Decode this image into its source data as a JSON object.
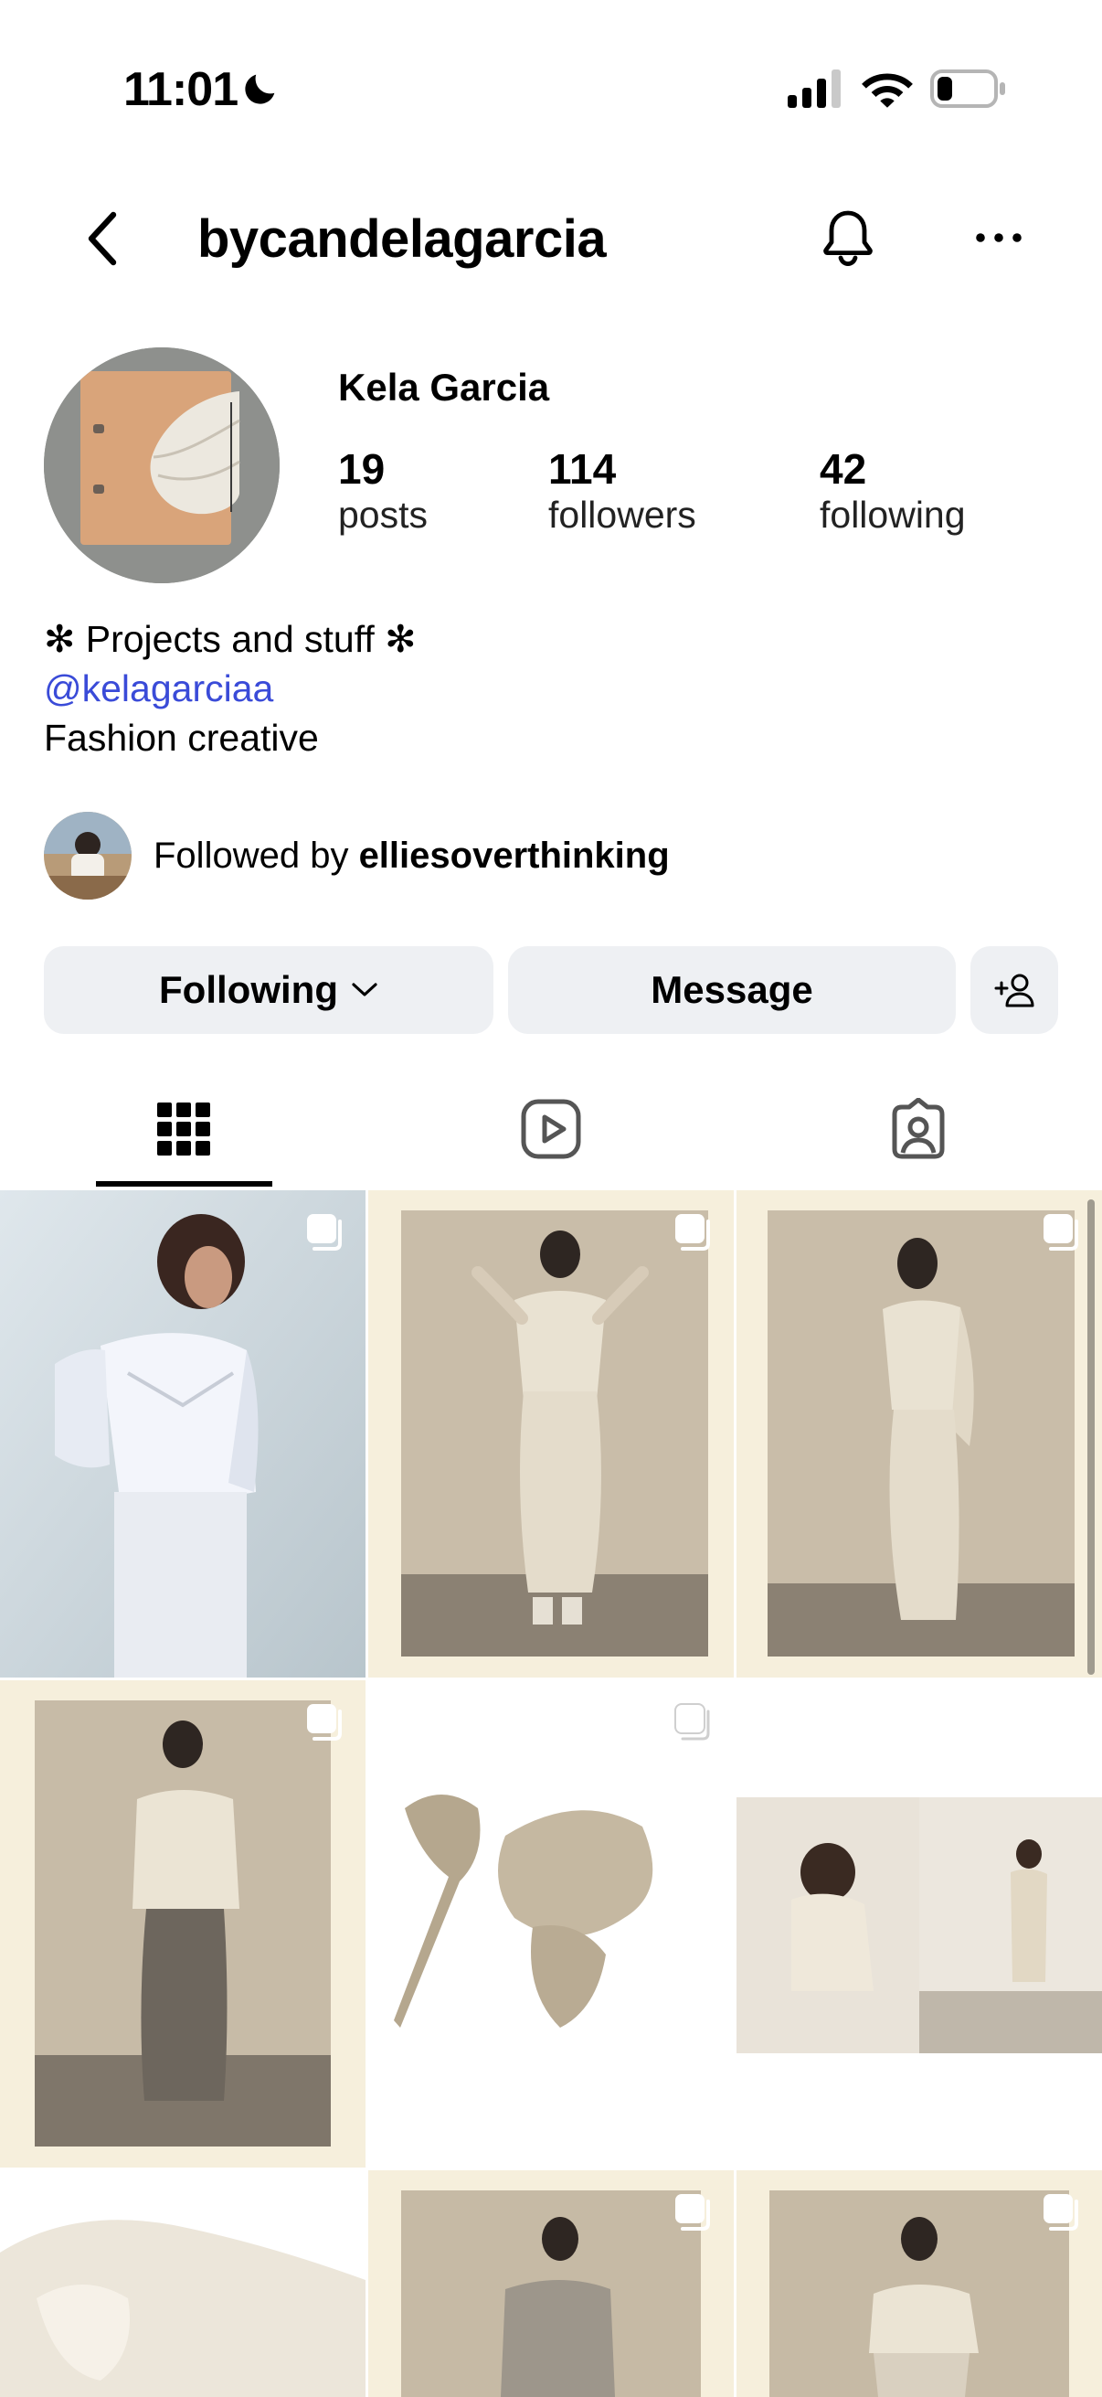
{
  "status_bar": {
    "time": "11:01"
  },
  "header": {
    "username": "bycandelagarcia"
  },
  "profile": {
    "display_name": "Kela Garcia",
    "stats": {
      "posts": {
        "value": "19",
        "label": "posts"
      },
      "followers": {
        "value": "114",
        "label": "followers"
      },
      "following": {
        "value": "42",
        "label": "following"
      }
    },
    "bio": {
      "line1": "✻ Projects and stuff ✻",
      "mention": "@kelagarciaa",
      "line3": "Fashion creative"
    },
    "followed_by": {
      "prefix": "Followed by ",
      "user": "elliesoverthinking"
    }
  },
  "actions": {
    "following_label": "Following",
    "message_label": "Message"
  },
  "tabs": [
    {
      "icon": "grid-icon",
      "active": true
    },
    {
      "icon": "reels-icon",
      "active": false
    },
    {
      "icon": "tagged-icon",
      "active": false
    }
  ],
  "colors": {
    "link": "#3a4bd8",
    "button_bg": "#eef0f3"
  }
}
